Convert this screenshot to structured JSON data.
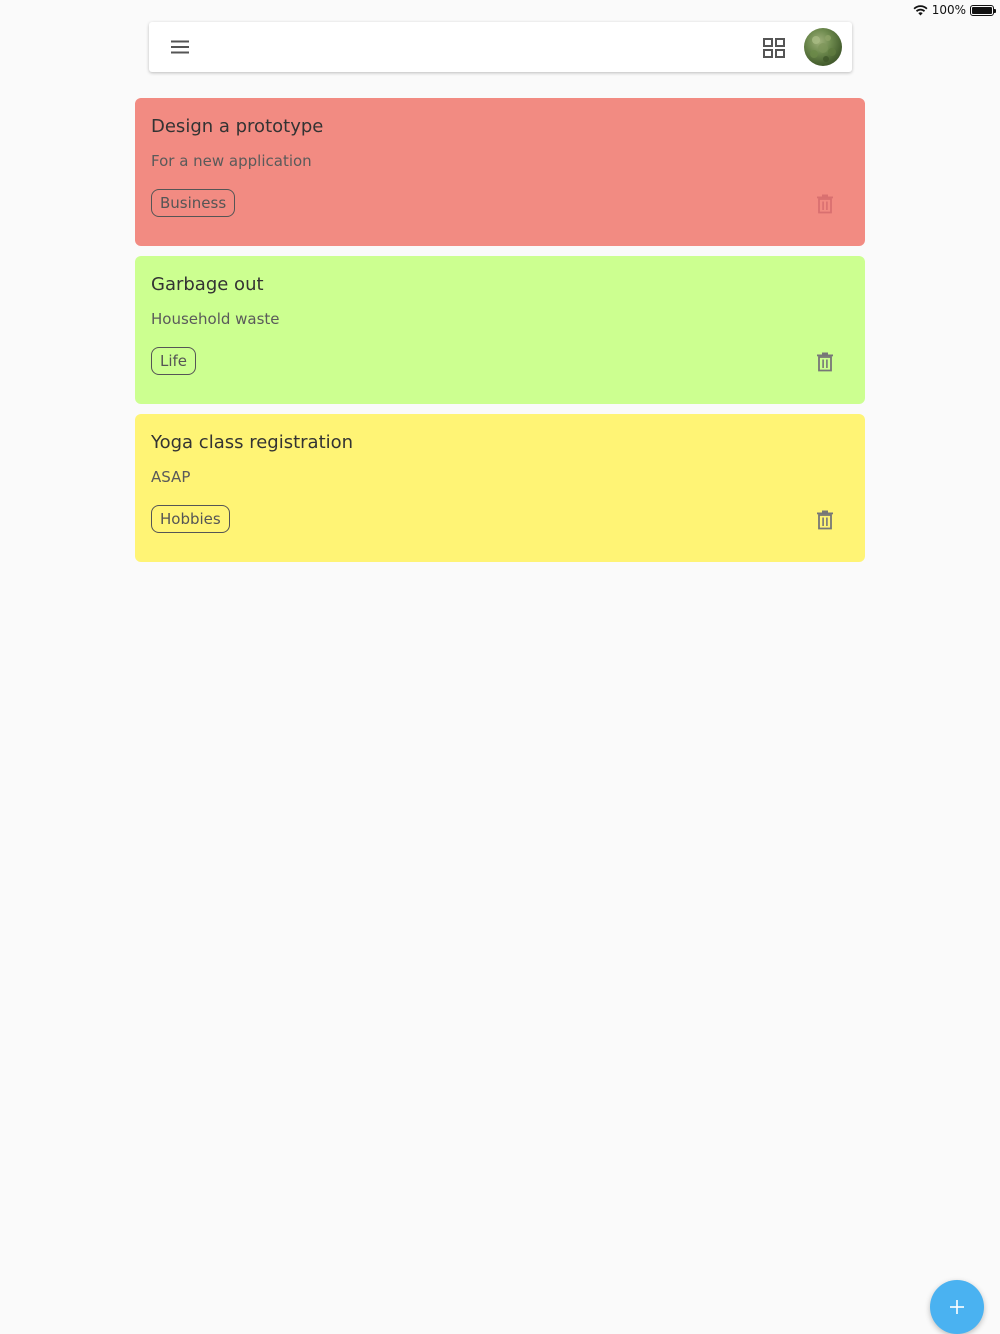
{
  "status_bar": {
    "battery_text": "100%",
    "wifi_icon": "wifi-icon",
    "battery_icon": "battery-icon"
  },
  "toolbar": {
    "menu_icon": "hamburger-menu-icon",
    "view_toggle_icon": "grid-view-icon",
    "avatar": "user-avatar"
  },
  "notes": [
    {
      "title": "Design a prototype",
      "description": "For a new application",
      "tag": "Business",
      "color": "#f28b82"
    },
    {
      "title": "Garbage out",
      "description": "Household waste",
      "tag": "Life",
      "color": "#ccff90"
    },
    {
      "title": "Yoga class registration",
      "description": "ASAP",
      "tag": "Hobbies",
      "color": "#fff475"
    }
  ],
  "fab": {
    "icon": "plus-icon",
    "color": "#4ab2f1"
  }
}
